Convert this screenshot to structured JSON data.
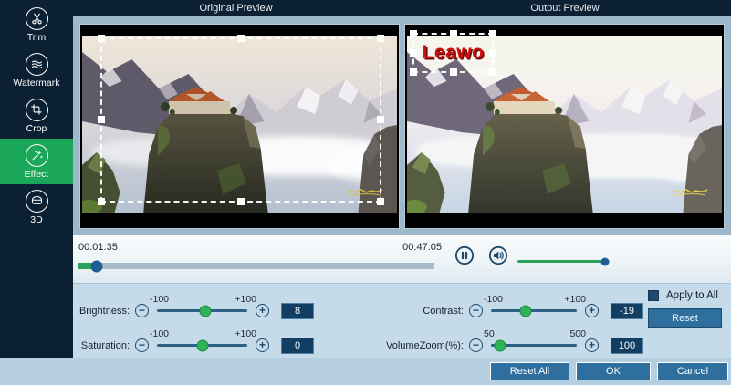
{
  "sidebar": {
    "items": [
      {
        "label": "Trim"
      },
      {
        "label": "Watermark"
      },
      {
        "label": "Crop"
      },
      {
        "label": "Effect"
      },
      {
        "label": "3D"
      }
    ],
    "active_item": "Effect"
  },
  "header": {
    "original_title": "Original Preview",
    "output_title": "Output Preview"
  },
  "previews": {
    "output_watermark_text": "Leawo"
  },
  "player": {
    "elapsed": "00:01:35",
    "duration": "00:47:05",
    "progress_percent": 5,
    "volume_percent": 96
  },
  "adjustments": {
    "sliders": [
      {
        "label": "Brightness:",
        "min": -100,
        "max": 100,
        "min_label": "-100",
        "max_label": "+100",
        "value": 8
      },
      {
        "label": "Contrast:",
        "min": -100,
        "max": 100,
        "min_label": "-100",
        "max_label": "+100",
        "value": -19
      },
      {
        "label": "Saturation:",
        "min": -100,
        "max": 100,
        "min_label": "-100",
        "max_label": "+100",
        "value": 0
      },
      {
        "label": "VolumeZoom(%):",
        "min": 50,
        "max": 500,
        "min_label": "50",
        "max_label": "500",
        "value": 100
      }
    ],
    "apply_to_all_label": "Apply to All",
    "reset_label": "Reset"
  },
  "footer": {
    "reset_all_label": "Reset All",
    "ok_label": "OK",
    "cancel_label": "Cancel"
  },
  "icons": {
    "minus": "−",
    "plus": "+"
  },
  "colors": {
    "navy": "#0c2033",
    "active_green": "#1aa75a",
    "button_blue": "#2f6f9f",
    "value_box": "#123e63",
    "watermark_red": "#d01010",
    "progress_green": "#2aa25b",
    "slider_green": "#2eb457",
    "control_navy": "#1c4a6b",
    "thumb_blue": "#1e5d94"
  }
}
